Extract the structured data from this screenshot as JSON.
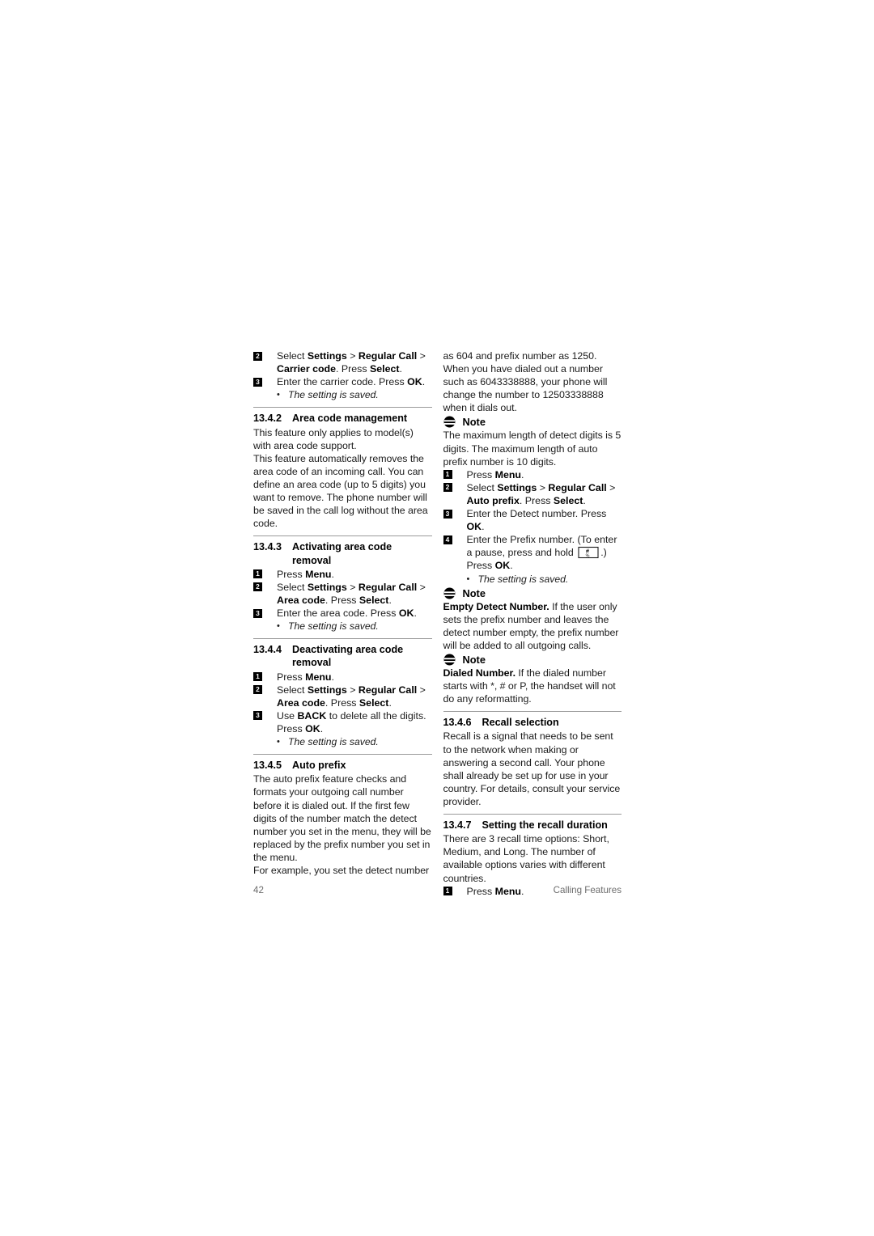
{
  "page": {
    "number": "42",
    "chapter": "Calling Features"
  },
  "icons": {
    "note": "note-icon",
    "hash_key": "hash-key-icon"
  },
  "left_column": {
    "carrier_steps": [
      {
        "n": "2",
        "html": "Select <b>Settings</b> &gt; <b>Regular Call</b> &gt; <b>Carrier code</b>. Press <b>Select</b>."
      },
      {
        "n": "3",
        "html": "Enter the carrier code. Press <b>OK</b>."
      }
    ],
    "carrier_saved": "The setting is saved.",
    "sec_13_4_2": {
      "num": "13.4.2",
      "title": "Area code management",
      "paras": [
        "This feature only applies to model(s) with area code support.",
        "This feature automatically removes the area code of an incoming call. You can define an area code (up to 5 digits) you want to remove. The phone number will be saved in the call log without the area code."
      ]
    },
    "sec_13_4_3": {
      "num": "13.4.3",
      "title": "Activating area code removal",
      "steps": [
        {
          "n": "1",
          "html": "Press <b>Menu</b>."
        },
        {
          "n": "2",
          "html": "Select <b>Settings</b> &gt; <b>Regular Call</b> &gt; <b>Area code</b>. Press <b>Select</b>."
        },
        {
          "n": "3",
          "html": "Enter the area code. Press <b>OK</b>."
        }
      ],
      "saved": "The setting is saved."
    },
    "sec_13_4_4": {
      "num": "13.4.4",
      "title": "Deactivating area code removal",
      "steps": [
        {
          "n": "1",
          "html": "Press <b>Menu</b>."
        },
        {
          "n": "2",
          "html": "Select <b>Settings</b> &gt; <b>Regular Call</b> &gt; <b>Area code</b>. Press <b>Select</b>."
        },
        {
          "n": "3",
          "html": "Use <b>BACK</b> to delete all the digits. Press <b>OK</b>."
        }
      ],
      "saved": "The setting is saved."
    },
    "sec_13_4_5": {
      "num": "13.4.5",
      "title": "Auto prefix",
      "paras": [
        "The auto prefix feature checks and formats your outgoing call number before it is dialed out. If the first few digits of the number match the detect number you set in the menu, they will be replaced by the prefix number you set in the menu.",
        "For example, you set the detect number"
      ]
    }
  },
  "right_column": {
    "continued_para": "as 604 and prefix number as 1250. When you have dialed out a number such as 6043338888, your phone will change the number to 12503338888 when it dials out.",
    "note1": {
      "label": "Note",
      "body": "The maximum length of detect digits is 5 digits. The maximum length of auto prefix number is 10 digits."
    },
    "prefix_steps": [
      {
        "n": "1",
        "html": "Press <b>Menu</b>."
      },
      {
        "n": "2",
        "html": "Select <b>Settings</b> &gt; <b>Regular Call</b> &gt; <b>Auto prefix</b>. Press <b>Select</b>."
      },
      {
        "n": "3",
        "html": "Enter the Detect number. Press <b>OK</b>."
      },
      {
        "n": "4",
        "html": "Enter the Prefix number. (To enter a pause, press and hold __KEY__.) Press <b>OK</b>."
      }
    ],
    "prefix_saved": "The setting is saved.",
    "note2": {
      "label": "Note",
      "html": "<b>Empty Detect Number.</b> If the user only sets the prefix number and leaves the detect number empty, the prefix number will be added to all outgoing calls."
    },
    "note3": {
      "label": "Note",
      "html": "<b>Dialed Number.</b> If the dialed number starts with *, # or P, the handset will not do any reformatting."
    },
    "sec_13_4_6": {
      "num": "13.4.6",
      "title": "Recall selection",
      "para": "Recall is a signal that needs to be sent to the network when making or answering a second call. Your phone shall already be set up for use in your country. For details, consult your service provider."
    },
    "sec_13_4_7": {
      "num": "13.4.7",
      "title": "Setting the recall duration",
      "para": "There are 3 recall time options: Short, Medium, and Long. The number of available options varies with different countries.",
      "steps": [
        {
          "n": "1",
          "html": "Press <b>Menu</b>."
        }
      ]
    }
  }
}
